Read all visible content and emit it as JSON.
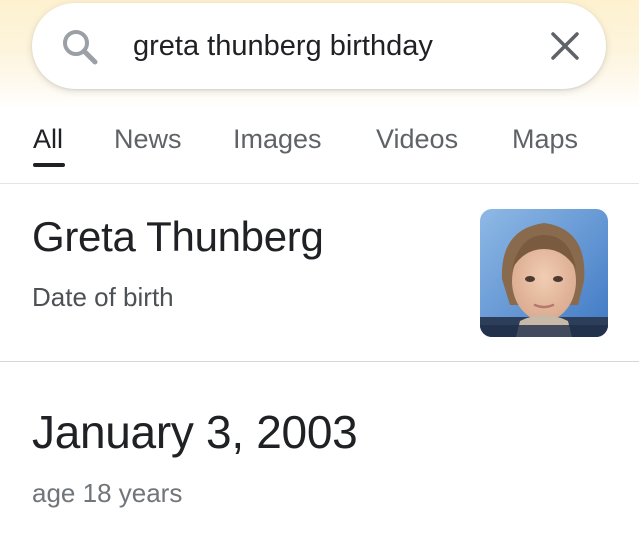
{
  "search": {
    "query": "greta thunberg birthday",
    "icon": "search-icon",
    "clear_icon": "close-icon"
  },
  "tabs": [
    {
      "label": "All",
      "active": true
    },
    {
      "label": "News",
      "active": false
    },
    {
      "label": "Images",
      "active": false
    },
    {
      "label": "Videos",
      "active": false
    },
    {
      "label": "Maps",
      "active": false
    }
  ],
  "entity": {
    "name": "Greta Thunberg",
    "subtitle": "Date of birth"
  },
  "answer": {
    "value": "January 3, 2003",
    "age": "age 18 years"
  },
  "colors": {
    "text_primary": "#202124",
    "text_secondary": "#5f6368",
    "search_icon": "#9aa0a6",
    "header_tint": "#fdf1cf"
  }
}
